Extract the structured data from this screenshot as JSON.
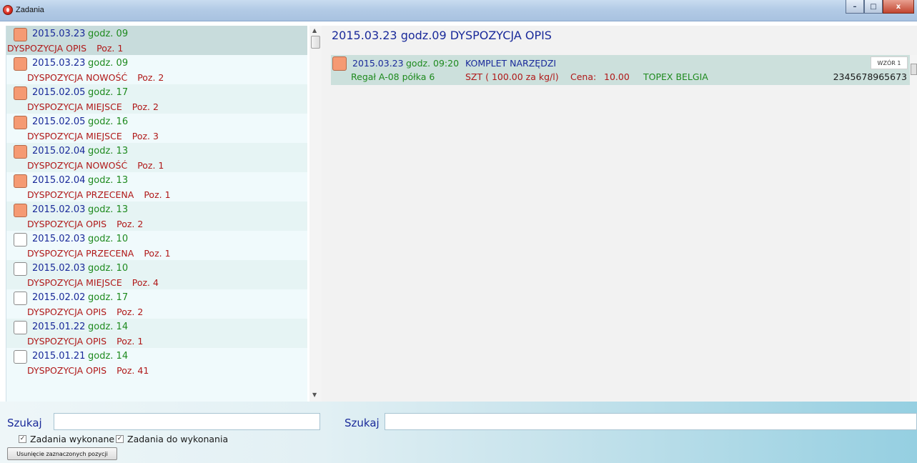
{
  "window": {
    "title": "Zadania",
    "min": "–",
    "max": "□",
    "close": "x"
  },
  "tasks": [
    {
      "date": "2015.03.23",
      "time": "godz. 09",
      "type": "DYSPOZYCJA OPIS",
      "poz": "Poz. 1",
      "done": true,
      "selected": true
    },
    {
      "date": "2015.03.23",
      "time": "godz. 09",
      "type": "DYSPOZYCJA NOWOŚĆ",
      "poz": "Poz. 2",
      "done": true
    },
    {
      "date": "2015.02.05",
      "time": "godz. 17",
      "type": "DYSPOZYCJA MIEJSCE",
      "poz": "Poz. 2",
      "done": true
    },
    {
      "date": "2015.02.05",
      "time": "godz. 16",
      "type": "DYSPOZYCJA MIEJSCE",
      "poz": "Poz. 3",
      "done": true
    },
    {
      "date": "2015.02.04",
      "time": "godz. 13",
      "type": "DYSPOZYCJA NOWOŚĆ",
      "poz": "Poz. 1",
      "done": true
    },
    {
      "date": "2015.02.04",
      "time": "godz. 13",
      "type": "DYSPOZYCJA PRZECENA",
      "poz": "Poz. 1",
      "done": true
    },
    {
      "date": "2015.02.03",
      "time": "godz. 13",
      "type": "DYSPOZYCJA OPIS",
      "poz": "Poz. 2",
      "done": true
    },
    {
      "date": "2015.02.03",
      "time": "godz. 10",
      "type": "DYSPOZYCJA PRZECENA",
      "poz": "Poz. 1",
      "done": false
    },
    {
      "date": "2015.02.03",
      "time": "godz. 10",
      "type": "DYSPOZYCJA MIEJSCE",
      "poz": "Poz. 4",
      "done": false
    },
    {
      "date": "2015.02.02",
      "time": "godz. 17",
      "type": "DYSPOZYCJA OPIS",
      "poz": "Poz. 2",
      "done": false
    },
    {
      "date": "2015.01.22",
      "time": "godz. 14",
      "type": "DYSPOZYCJA OPIS",
      "poz": "Poz. 1",
      "done": false
    },
    {
      "date": "2015.01.21",
      "time": "godz. 14",
      "type": "DYSPOZYCJA OPIS",
      "poz": "Poz. 41",
      "done": false
    }
  ],
  "detail": {
    "title": "2015.03.23 godz.09 DYSPOZYCJA OPIS",
    "item": {
      "date": "2015.03.23",
      "time": "godz. 09:20",
      "name": "KOMPLET NARZĘDZI",
      "template_button": "WZÓR 1",
      "location": "Regał A-08 półka 6",
      "unit": "SZT ( 100.00 za kg/l)",
      "price_label": "Cena:",
      "price_value": "10.00",
      "supplier": "TOPEX BELGIA",
      "code": "2345678965673"
    }
  },
  "bottom": {
    "search_left_label": "Szukaj",
    "search_left_value": "",
    "search_right_label": "Szukaj",
    "search_right_value": "",
    "filter_done_label": "Zadania wykonane",
    "filter_done_checked": true,
    "filter_todo_label": "Zadania do wykonania",
    "filter_todo_checked": true,
    "delete_button": "Usunięcie zaznaczonych pozycji"
  },
  "colors": {
    "date": "#1a2a9a",
    "time": "#1e8a1e",
    "type": "#b01818",
    "checkbox_done": "#f59a73"
  }
}
